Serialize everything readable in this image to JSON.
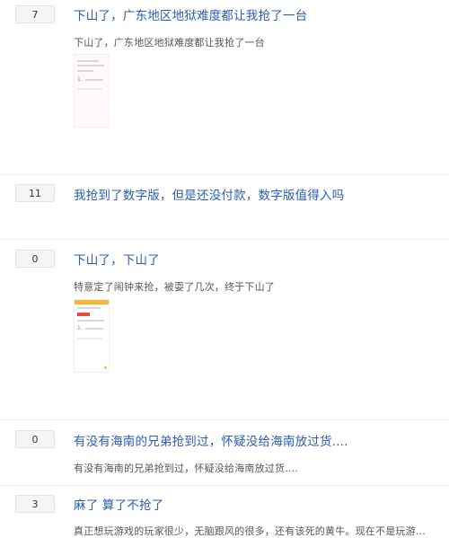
{
  "posts": [
    {
      "count": "7",
      "title": "下山了，广东地区地狱难度都让我抢了一台",
      "excerpt": "下山了，广东地区地狱难度都让我抢了一台"
    },
    {
      "count": "11",
      "title": "我抢到了数字版，但是还没付款，数字版值得入吗",
      "excerpt": ""
    },
    {
      "count": "0",
      "title": "下山了，下山了",
      "excerpt": "特意定了闹钟来抢，被耍了几次，终于下山了"
    },
    {
      "count": "0",
      "title": "有没有海南的兄弟抢到过，怀疑没给海南放过货....",
      "excerpt": "有没有海南的兄弟抢到过，怀疑没给海南放过货...."
    },
    {
      "count": "3",
      "title": "麻了 算了不抢了",
      "excerpt": "真正想玩游戏的玩家很少，无脑跟风的很多，还有该死的黄牛。现在不是玩游..."
    }
  ],
  "thumb_marks": [
    "1.",
    "1."
  ]
}
